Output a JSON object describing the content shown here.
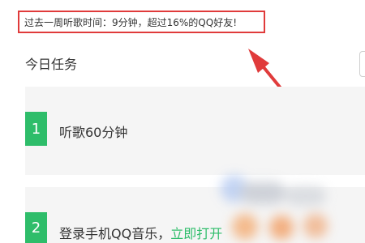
{
  "banner": {
    "text": "过去一周听歌时间：9分钟，超过16%的QQ好友!"
  },
  "tasks_section": {
    "title": "今日任务",
    "items": [
      {
        "number": "1",
        "label": "听歌60分钟"
      },
      {
        "number": "2",
        "label": "登录手机QQ音乐，",
        "action": "立即打开"
      }
    ]
  },
  "colors": {
    "accent_green": "#2ebd6a",
    "annotation_red": "#e03b3b",
    "card_bg": "#f5f5f5"
  },
  "icons": {
    "annotation": "red-arrow-icon"
  }
}
